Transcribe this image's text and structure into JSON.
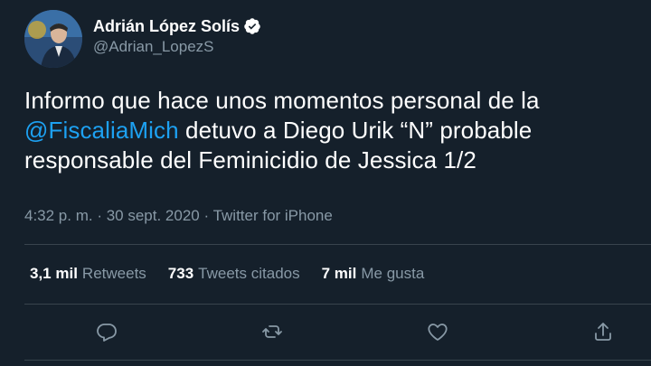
{
  "author": {
    "name": "Adrián López Solís",
    "handle": "@Adrian_LopezS"
  },
  "tweet": {
    "text_before": "Informo que hace unos momentos personal de la ",
    "mention": "@FiscaliaMich",
    "text_after": " detuvo a Diego Urik “N” probable responsable del Feminicidio de Jessica 1/2"
  },
  "meta": {
    "time": "4:32 p. m.",
    "separator1": " · ",
    "date": "30 sept. 2020",
    "separator2": " · ",
    "source": "Twitter for iPhone"
  },
  "stats": {
    "retweets_count": "3,1 mil",
    "retweets_label": "Retweets",
    "quotes_count": "733",
    "quotes_label": "Tweets citados",
    "likes_count": "7 mil",
    "likes_label": "Me gusta"
  },
  "actions": {
    "reply_icon": "reply-icon",
    "retweet_icon": "retweet-icon",
    "like_icon": "heart-icon",
    "share_icon": "share-icon"
  },
  "colors": {
    "background": "#15202b",
    "text": "#ffffff",
    "secondary": "#8899a6",
    "accent": "#1da1f2",
    "divider": "#38444d"
  }
}
